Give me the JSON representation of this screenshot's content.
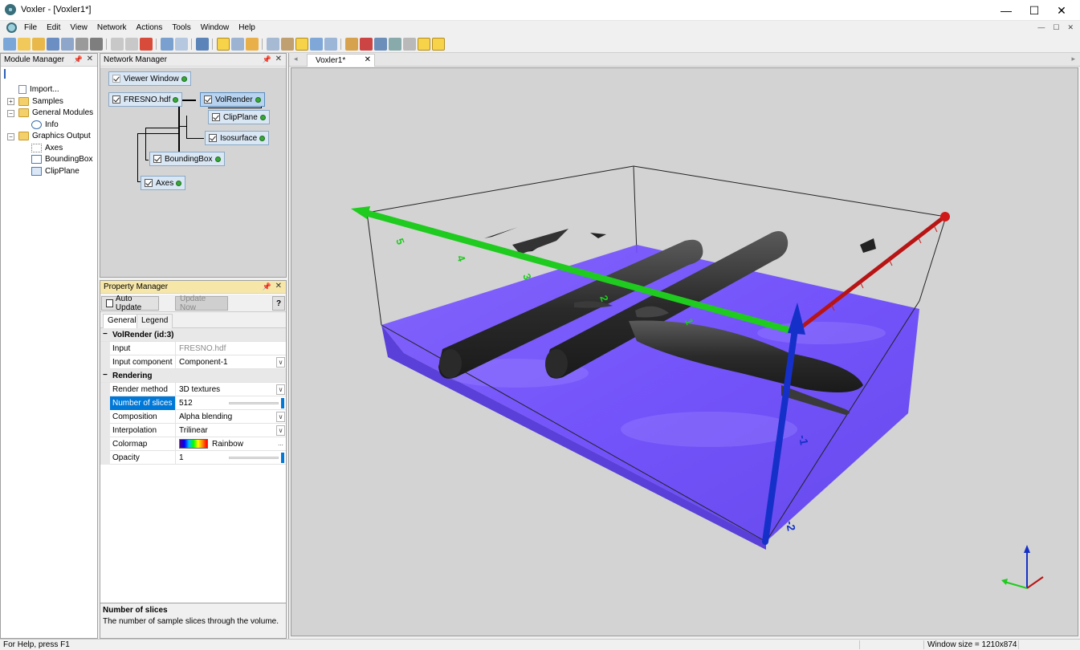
{
  "window": {
    "title": "Voxler - [Voxler1*]",
    "minimize": "—",
    "maximize": "☐",
    "close": "✕"
  },
  "menu": [
    "File",
    "Edit",
    "View",
    "Network",
    "Actions",
    "Tools",
    "Window",
    "Help"
  ],
  "mdi_buttons": [
    "—",
    "☐",
    "✕"
  ],
  "module_manager": {
    "title": "Module Manager",
    "items": [
      {
        "label": "Import...",
        "icon": "import-icon"
      },
      {
        "label": "Samples",
        "icon": "folder-icon"
      },
      {
        "label": "General Modules",
        "icon": "folder-icon"
      },
      {
        "label": "Info",
        "icon": "info-icon"
      },
      {
        "label": "Graphics Output",
        "icon": "folder-icon"
      },
      {
        "label": "Axes",
        "icon": "axes-icon"
      },
      {
        "label": "BoundingBox",
        "icon": "bounding-box-icon"
      },
      {
        "label": "ClipPlane",
        "icon": "clip-plane-icon"
      }
    ]
  },
  "network_manager": {
    "title": "Network Manager",
    "nodes": [
      {
        "label": "Viewer Window"
      },
      {
        "label": "FRESNO.hdf"
      },
      {
        "label": "VolRender"
      },
      {
        "label": "ClipPlane"
      },
      {
        "label": "Isosurface"
      },
      {
        "label": "BoundingBox"
      },
      {
        "label": "Axes"
      }
    ]
  },
  "property_manager": {
    "title": "Property Manager",
    "auto_update_label": "Auto Update",
    "update_now_label": "Update Now",
    "help_label": "?",
    "tabs": [
      "General",
      "Legend"
    ],
    "section_volrender": "VolRender (id:3)",
    "section_rendering": "Rendering",
    "rows": {
      "input": {
        "label": "Input",
        "value": "FRESNO.hdf"
      },
      "input_component": {
        "label": "Input component",
        "value": "Component-1"
      },
      "render_method": {
        "label": "Render method",
        "value": "3D textures"
      },
      "number_of_slices": {
        "label": "Number of slices",
        "value": "512"
      },
      "composition": {
        "label": "Composition",
        "value": "Alpha blending"
      },
      "interpolation": {
        "label": "Interpolation",
        "value": "Trilinear"
      },
      "colormap": {
        "label": "Colormap",
        "value": "Rainbow",
        "more": "..."
      },
      "opacity": {
        "label": "Opacity",
        "value": "1"
      }
    },
    "help_title": "Number of slices",
    "help_text": "The number of sample slices through the volume."
  },
  "viewer": {
    "tab_label": "Voxler1*",
    "background": "#d3d3d3",
    "green_axis_labels": [
      "5",
      "4",
      "3",
      "2",
      "1"
    ],
    "blue_axis_labels": [
      "-1",
      "-2"
    ]
  },
  "status": {
    "help": "For Help, press F1",
    "window_size": "Window size = 1210x874"
  },
  "colors": {
    "selection": "#0078d7",
    "volume": "#6a48ff",
    "x_axis": "#b81414",
    "y_axis": "#1ecb1e",
    "z_axis": "#1530c8"
  }
}
